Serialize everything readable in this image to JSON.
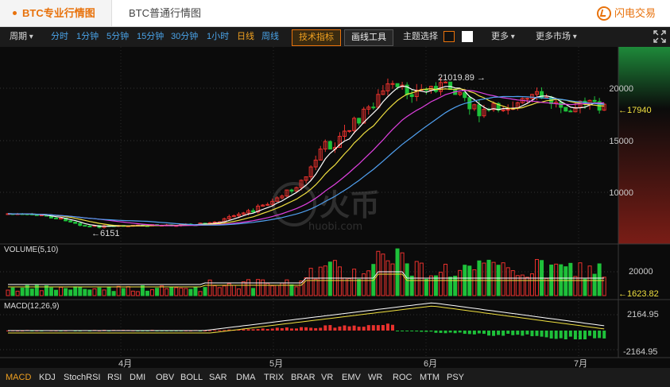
{
  "tabs": [
    {
      "label": "BTC专业行情图",
      "active": true
    },
    {
      "label": "BTC普通行情图",
      "active": false
    }
  ],
  "brand": {
    "label": "闪电交易"
  },
  "toolbar": {
    "period_label": "周期",
    "periods": [
      "分时",
      "1分钟",
      "5分钟",
      "15分钟",
      "30分钟",
      "1小时",
      "日线",
      "周线"
    ],
    "active_period": "日线",
    "tech_indicator_button": "技术指标",
    "drawing_tools_button": "画线工具",
    "theme_label": "主题选择",
    "more_label": "更多",
    "more_markets_label": "更多市场"
  },
  "chart": {
    "watermark_text": "火币",
    "watermark_url": "huobi.com",
    "price_axis_ticks": [
      "20000",
      "15000",
      "10000"
    ],
    "current_price": "17940",
    "high_label": "21019.89",
    "low_label": "6151",
    "volume_title": "VOLUME(5,10)",
    "volume_axis_ticks": [
      "20000"
    ],
    "volume_current": "1623.82",
    "macd_title": "MACD(12,26,9)",
    "macd_axis_ticks": [
      "2164.95",
      "-2164.95"
    ],
    "x_ticks": [
      "4月",
      "5月",
      "6月",
      "7月"
    ],
    "colors": {
      "up": "#e8312d",
      "down": "#1ec13a",
      "ma5": "#ffffff",
      "ma10": "#f0e040",
      "ma20": "#e040e0",
      "ma30": "#50a0f0",
      "accent": "#e8720c"
    }
  },
  "indicators": [
    "MACD",
    "KDJ",
    "StochRSI",
    "RSI",
    "DMI",
    "OBV",
    "BOLL",
    "SAR",
    "DMA",
    "TRIX",
    "BRAR",
    "VR",
    "EMV",
    "WR",
    "ROC",
    "MTM",
    "PSY"
  ],
  "active_indicator": "MACD"
}
